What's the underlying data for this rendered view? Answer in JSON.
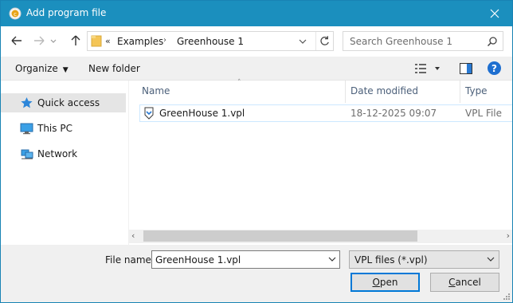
{
  "window": {
    "title": "Add program file",
    "app_icon": "app-icon",
    "close_icon": "close-icon"
  },
  "nav": {
    "back_icon": "back-arrow-icon",
    "forward_icon": "forward-arrow-icon",
    "up_icon": "up-arrow-icon"
  },
  "address": {
    "overflow": "«",
    "crumbs": [
      "Examples",
      "Greenhouse 1"
    ],
    "separator_icon": "chevron-right-icon",
    "refresh_icon": "refresh-icon"
  },
  "search": {
    "placeholder": "Search Greenhouse 1",
    "icon": "search-icon"
  },
  "toolbar": {
    "organize_label": "Organize",
    "new_folder_label": "New folder",
    "views_icon": "view-options-icon",
    "preview_icon": "preview-pane-icon",
    "help_icon": "help-icon"
  },
  "sidebar": {
    "items": [
      {
        "label": "Quick access",
        "icon": "star-icon",
        "selected": true
      },
      {
        "label": "This PC",
        "icon": "computer-icon",
        "selected": false
      },
      {
        "label": "Network",
        "icon": "network-icon",
        "selected": false
      }
    ]
  },
  "file_list": {
    "columns": [
      "Name",
      "Date modified",
      "Type"
    ],
    "sort_column": "Name",
    "rows": [
      {
        "name": "GreenHouse 1.vpl",
        "date_modified": "18-12-2025 09:07",
        "type": "VPL File"
      }
    ]
  },
  "footer": {
    "file_name_label": "File name:",
    "file_name_value": "GreenHouse 1.vpl",
    "file_type_value": "VPL files (*.vpl)",
    "open_label": "Open",
    "cancel_label": "Cancel"
  },
  "colors": {
    "titlebar": "#1b8fbe",
    "accent": "#0078d7",
    "folder": "#f4c556",
    "selection": "#cce8ff"
  }
}
